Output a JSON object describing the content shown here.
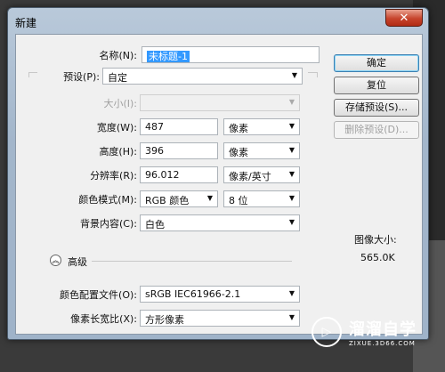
{
  "window": {
    "title": "新建",
    "close_label": "✕"
  },
  "form": {
    "name_label": "名称(N):",
    "name_value": "未标题-1",
    "preset_label": "预设(P):",
    "preset_value": "自定",
    "size_label": "大小(I):",
    "size_value": "",
    "width_label": "宽度(W):",
    "width_value": "487",
    "width_unit": "像素",
    "height_label": "高度(H):",
    "height_value": "396",
    "height_unit": "像素",
    "resolution_label": "分辨率(R):",
    "resolution_value": "96.012",
    "resolution_unit": "像素/英寸",
    "color_mode_label": "颜色模式(M):",
    "color_mode_value": "RGB 颜色",
    "bit_depth_value": "8 位",
    "background_label": "背景内容(C):",
    "background_value": "白色",
    "advanced_label": "高级",
    "advanced_icon": "collapse-chevron",
    "color_profile_label": "颜色配置文件(O):",
    "color_profile_value": "sRGB IEC61966-2.1",
    "pixel_aspect_label": "像素长宽比(X):",
    "pixel_aspect_value": "方形像素"
  },
  "buttons": {
    "ok": "确定",
    "reset": "复位",
    "save_preset": "存储预设(S)...",
    "delete_preset": "删除预设(D)..."
  },
  "image_size": {
    "title": "图像大小:",
    "value": "565.0K"
  },
  "watermark": {
    "main": "溜溜自学",
    "sub": "ZIXUE.3D66.COM"
  },
  "colors": {
    "selection": "#3399ff",
    "dialog_bg": "#f0f0f0",
    "title_bar": "#a3b6cb",
    "close": "#c7442c"
  }
}
